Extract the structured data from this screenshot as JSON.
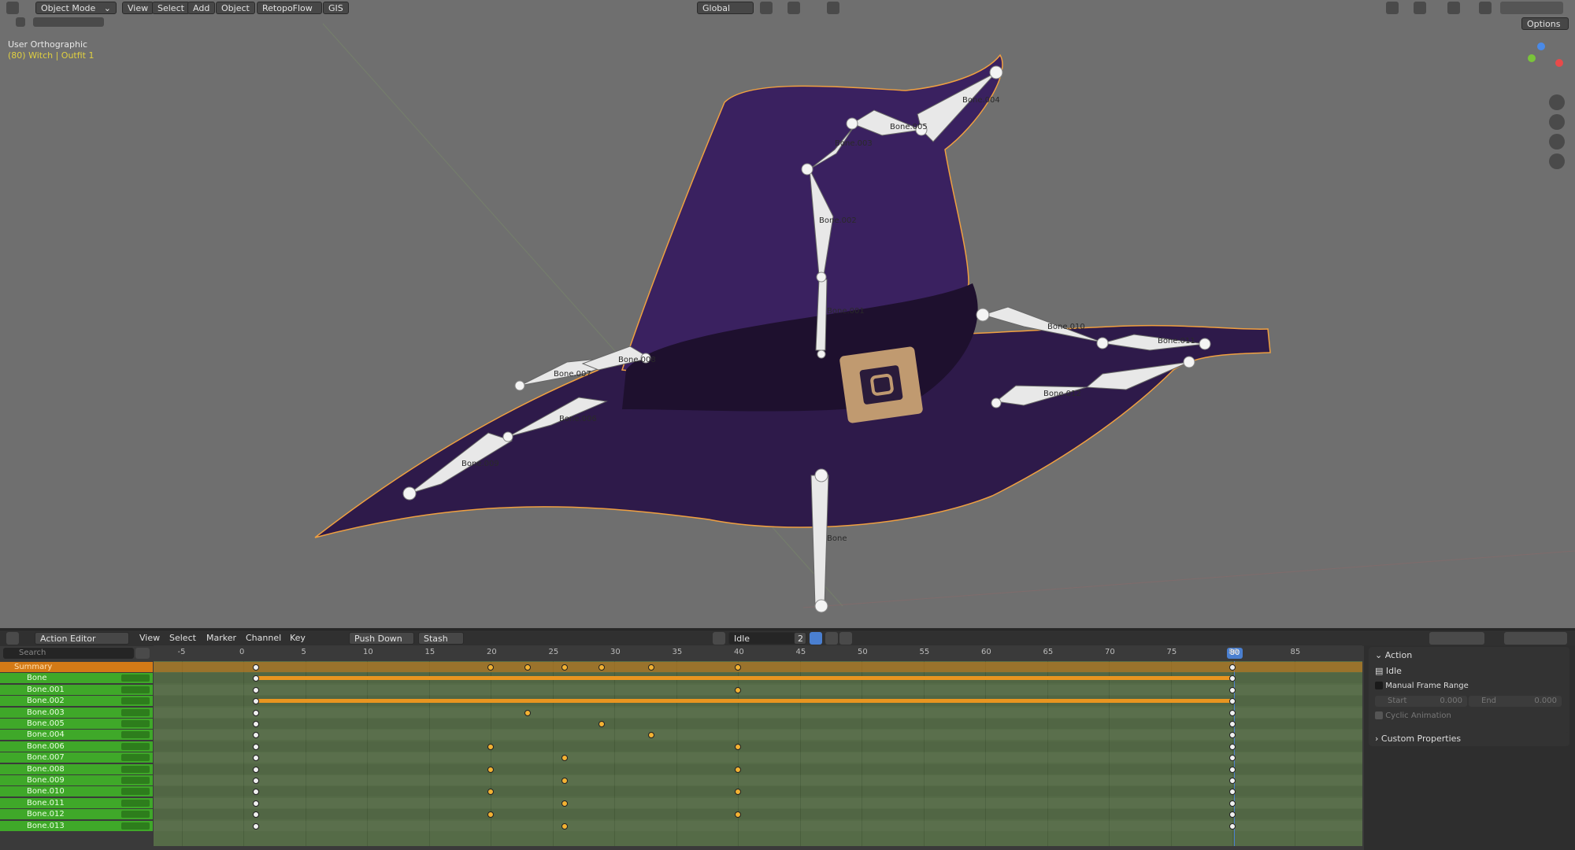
{
  "viewport": {
    "mode": "Object Mode",
    "menus": [
      "View",
      "Select",
      "Add",
      "Object"
    ],
    "addon_buttons": [
      "RetopoFlow",
      "GIS"
    ],
    "orientation": "Global",
    "view_name": "User Orthographic",
    "object_info": "(80) Witch | Outfit 1",
    "options_label": "Options",
    "bones": [
      {
        "label": "Bone"
      },
      {
        "label": "Bone.001"
      },
      {
        "label": "Bone.002"
      },
      {
        "label": "Bone.003"
      },
      {
        "label": "Bone.004"
      },
      {
        "label": "Bone.005"
      },
      {
        "label": "Bone.006"
      },
      {
        "label": "Bone.007"
      },
      {
        "label": "Bone.008"
      },
      {
        "label": "Bone.009"
      },
      {
        "label": "Bone.010"
      },
      {
        "label": "Bone.011"
      },
      {
        "label": "Bone.012"
      }
    ]
  },
  "action_editor": {
    "editor_type": "Action Editor",
    "menus": [
      "View",
      "Select",
      "Marker",
      "Channel",
      "Key"
    ],
    "push_down": "Push Down",
    "stash": "Stash",
    "action_name": "Idle",
    "users": "2",
    "search_placeholder": "Search",
    "ruler": [
      "-5",
      "0",
      "5",
      "10",
      "15",
      "20",
      "25",
      "30",
      "35",
      "40",
      "45",
      "50",
      "55",
      "60",
      "65",
      "70",
      "75",
      "80",
      "85"
    ],
    "current_frame": "80",
    "channels": [
      {
        "name": "Summary",
        "keys": [
          1,
          20,
          23,
          26,
          29,
          33,
          40,
          80
        ]
      },
      {
        "name": "Bone",
        "keys": [
          1,
          80
        ]
      },
      {
        "name": "Bone.001",
        "keys": [
          1,
          40,
          80
        ]
      },
      {
        "name": "Bone.002",
        "keys": [
          1,
          80
        ]
      },
      {
        "name": "Bone.003",
        "keys": [
          1,
          23,
          80
        ]
      },
      {
        "name": "Bone.005",
        "keys": [
          1,
          29,
          80
        ]
      },
      {
        "name": "Bone.004",
        "keys": [
          1,
          33,
          80
        ]
      },
      {
        "name": "Bone.006",
        "keys": [
          1,
          20,
          40,
          80
        ]
      },
      {
        "name": "Bone.007",
        "keys": [
          1,
          26,
          80
        ]
      },
      {
        "name": "Bone.008",
        "keys": [
          1,
          20,
          40,
          80
        ]
      },
      {
        "name": "Bone.009",
        "keys": [
          1,
          26,
          80
        ]
      },
      {
        "name": "Bone.010",
        "keys": [
          1,
          20,
          40,
          80
        ]
      },
      {
        "name": "Bone.011",
        "keys": [
          1,
          26,
          80
        ]
      },
      {
        "name": "Bone.012",
        "keys": [
          1,
          20,
          40,
          80
        ]
      },
      {
        "name": "Bone.013",
        "keys": [
          1,
          26,
          80
        ]
      }
    ],
    "sidebar": {
      "action_header": "Action",
      "action_name": "Idle",
      "manual_frame_range": "Manual Frame Range",
      "start_label": "Start",
      "start_value": "0.000",
      "end_label": "End",
      "end_value": "0.000",
      "cyclic": "Cyclic Animation",
      "custom_properties": "Custom Properties"
    }
  },
  "colors": {
    "viewport_bg": "#6f6f6f",
    "hat": "#2e1a4a",
    "outline": "#f0a040",
    "channel_green": "#3fa829",
    "summary_orange": "#d47a16",
    "keyframe": "#f3b233",
    "current_frame": "#4a7fd0"
  }
}
